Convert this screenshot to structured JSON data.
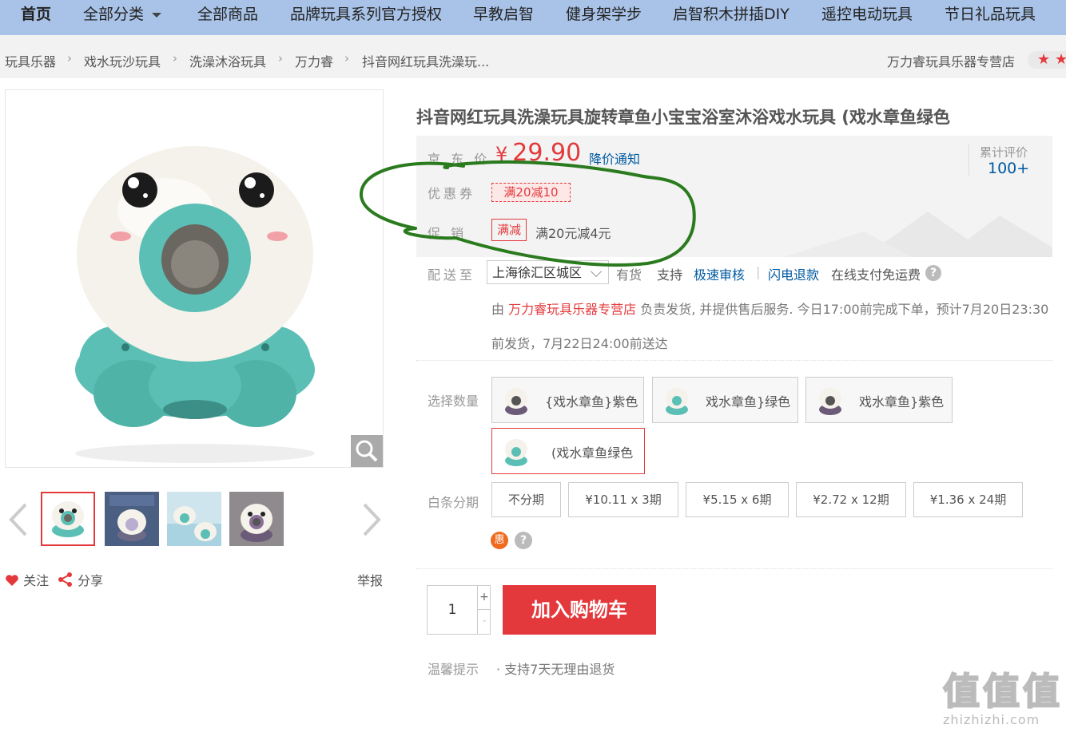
{
  "nav": {
    "home": "首页",
    "all_categories": "全部分类",
    "items": [
      "全部商品",
      "品牌玩具系列官方授权",
      "早教启智",
      "健身架学步",
      "启智积木拼插DIY",
      "遥控电动玩具",
      "节日礼品玩具"
    ]
  },
  "breadcrumb": [
    "玩具乐器",
    "戏水玩沙玩具",
    "洗澡沐浴玩具",
    "万力睿",
    "抖音网红玩具洗澡玩..."
  ],
  "shop": {
    "name": "万力睿玩具乐器专营店",
    "stars": "★★"
  },
  "product": {
    "title": "抖音网红玩具洗澡玩具旋转章鱼小宝宝浴室沐浴戏水玩具  (戏水章鱼绿色",
    "price_label": "京 东 价",
    "price_symbol": "¥",
    "price": "29.90",
    "price_notice": "降价通知",
    "rating_label": "累计评价",
    "rating_value": "100+",
    "coupon_label": "优惠券",
    "coupon": "满20减10",
    "promo_label": "促   销",
    "promo_tag": "满减",
    "promo_text": "满20元减4元"
  },
  "delivery": {
    "label": "配送至",
    "address": "上海徐汇区城区",
    "stock": "有货",
    "support": "支持",
    "svc1": "极速审核",
    "svc2": "闪电退款",
    "svc3": "在线支付免运费",
    "help": "?",
    "line1_prefix": "由",
    "line1_shop": "万力睿玩具乐器专营店",
    "line1_rest": "负责发货, 并提供售后服务. 今日17:00前完成下单，预计7月20日23:30",
    "line2": "前发货，7月22日24:00前送达"
  },
  "options": {
    "label": "选择数量",
    "items": [
      "{戏水章鱼}紫色",
      "戏水章鱼}绿色",
      "戏水章鱼}紫色",
      "(戏水章鱼绿色"
    ]
  },
  "installment": {
    "label": "白条分期",
    "items": [
      "不分期",
      "¥10.11 x 3期",
      "¥5.15 x 6期",
      "¥2.72 x 12期",
      "¥1.36 x 24期"
    ],
    "hui": "惠",
    "help": "?"
  },
  "actions": {
    "follow": "关注",
    "share": "分享",
    "report": "举报",
    "qty": "1",
    "plus": "+",
    "minus": "-",
    "cart": "加入购物车"
  },
  "tips": {
    "label": "温馨提示",
    "text": "· 支持7天无理由退货"
  },
  "watermark": {
    "mark": "值值值",
    "site": "zhizhizhi.com"
  },
  "colors": {
    "brand_red": "#e4393c",
    "link_blue": "#005aa0",
    "nav_bg": "#a9c3e8",
    "teal": "#5bbfb5",
    "annotation_green": "#2a7a1e"
  }
}
